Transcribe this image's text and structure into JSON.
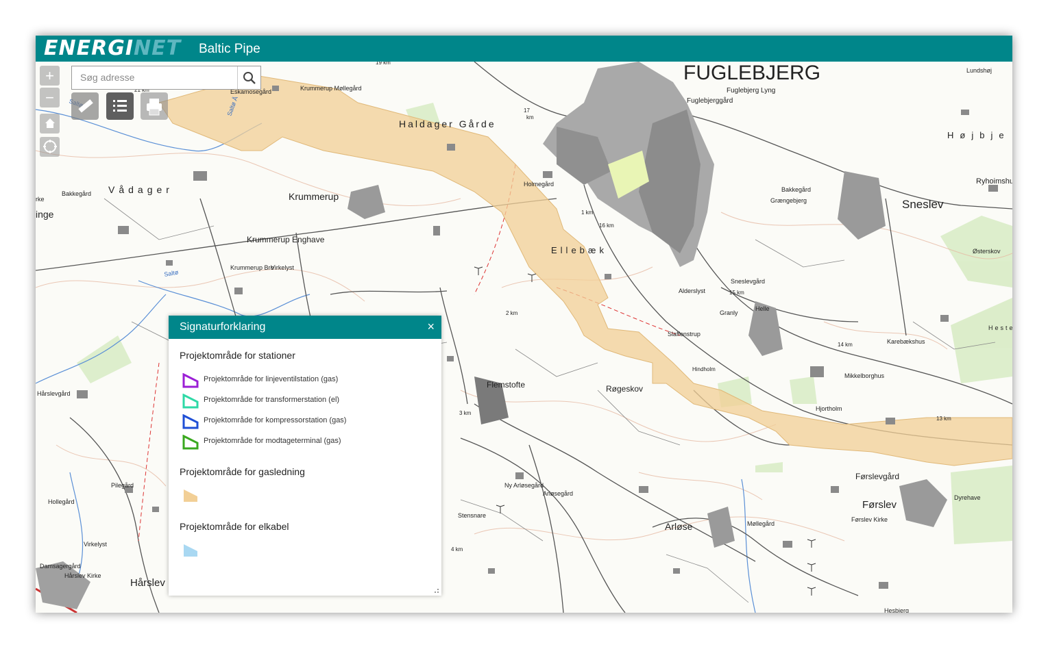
{
  "header": {
    "logo_part1": "ENERGI",
    "logo_part2": "NET",
    "app_title": "Baltic Pipe",
    "brand_color": "#00868a"
  },
  "search": {
    "placeholder": "Søg adresse",
    "value": ""
  },
  "map_controls": {
    "zoom_in_icon": "plus-icon",
    "zoom_out_icon": "minus-icon",
    "home_icon": "home-icon",
    "locate_icon": "locate-icon"
  },
  "toolbar": {
    "tools": [
      "measure-icon",
      "legend-list-icon",
      "print-icon"
    ]
  },
  "legend": {
    "title": "Signaturforklaring",
    "close_label": "×",
    "groups": [
      {
        "title": "Projektområde for stationer",
        "items": [
          {
            "label": "Projektområde for linjeventilstation (gas)",
            "color": "#9b1fd6"
          },
          {
            "label": "Projektområde for transformerstation (el)",
            "color": "#2ed9a6"
          },
          {
            "label": "Projektområde for kompressorstation (gas)",
            "color": "#1f4fd6"
          },
          {
            "label": "Projektområde for modtageterminal (gas)",
            "color": "#3aa81f"
          }
        ]
      },
      {
        "title": "Projektområde for gasledning",
        "fill": "#f2cf96"
      },
      {
        "title": "Projektområde for elkabel",
        "fill": "#a9d8f2"
      }
    ]
  },
  "map": {
    "corridor_color": "#f2cf96",
    "places": [
      "FUGLEBJERG",
      "Fuglebjerg Lyng",
      "Fuglebjerggård",
      "Haldager Gårde",
      "Krummerup Møllegård",
      "Eskamosegård",
      "Krummerup",
      "Vådager",
      "Bakkegård",
      "Krummerup Enghave",
      "Krummerup Bro",
      "Virkelyst",
      "Holmegård",
      "Ellebæk",
      "Bakkegård",
      "Grængebjerg",
      "Sneslev",
      "Højbjerg",
      "Ryhoimshus",
      "Østerskov",
      "Sneslevgård",
      "Alderslyst",
      "Helle",
      "Granly",
      "Slaffenstrup",
      "Hindholm",
      "Karebækshus",
      "Hestehave",
      "Mikkelborghus",
      "Hjortholm",
      "Flemstofte",
      "Røgeskov",
      "Førslevgård",
      "Førslev",
      "Førslev Kirke",
      "Dyrehave",
      "Arløse",
      "Møllegård",
      "Ny Arløsegård",
      "Arløsegård",
      "Stensnare",
      "Hårslevgård",
      "Pilegård",
      "Hollegård",
      "Virkelyst",
      "Damsagergård",
      "Hårslev Kirke",
      "Hårslev",
      "Lundshøj",
      "Saltø Å",
      "inge",
      "rke",
      "Hesbjerg"
    ],
    "km_marks": [
      "19 km",
      "21 km",
      "1 km",
      "16 km",
      "15 km",
      "2 km",
      "3 km",
      "4 km",
      "14 km",
      "13 km",
      "17 km"
    ]
  }
}
